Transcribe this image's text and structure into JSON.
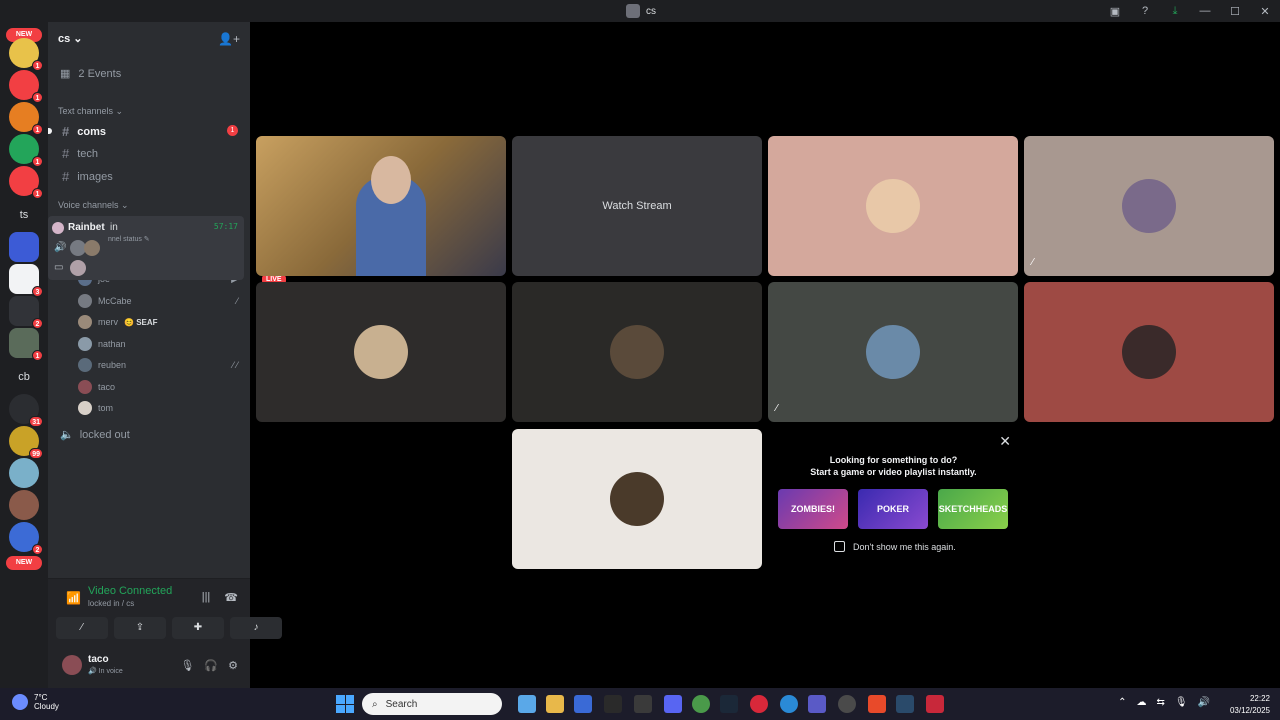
{
  "window": {
    "title": "cs"
  },
  "server": {
    "name": "cs",
    "events_label": "2 Events",
    "text_category": "Text channels",
    "text_channels": [
      {
        "name": "coms",
        "badge": "1"
      },
      {
        "name": "tech"
      },
      {
        "name": "images"
      }
    ],
    "voice_category": "Voice channels",
    "popup": {
      "server_name": "Rainbet",
      "channel_partial": "in",
      "timer": "57:17",
      "status_label": "nnel status"
    },
    "live_label": "LIVE",
    "voice_users": [
      {
        "name": "joe"
      },
      {
        "name": "McCabe"
      },
      {
        "name": "merv",
        "tag": "SEAF"
      },
      {
        "name": "nathan"
      },
      {
        "name": "reuben"
      },
      {
        "name": "taco"
      },
      {
        "name": "tom"
      }
    ],
    "locked_channel": "locked out"
  },
  "guilds": {
    "new_top": "NEW",
    "new_bottom": "NEW",
    "ts": "ts",
    "cb": "cb",
    "badges": [
      "1",
      "1",
      "1",
      "1",
      "1",
      "3",
      "2",
      "1",
      "31",
      "99",
      "2"
    ]
  },
  "voice_panel": {
    "status": "Video Connected",
    "subtitle": "locked in / cs"
  },
  "user": {
    "name": "taco",
    "status": "In voice"
  },
  "stage": {
    "watch_stream": "Watch Stream",
    "activity": {
      "line1": "Looking for something to do?",
      "line2": "Start a game or video playlist instantly.",
      "games": [
        "ZOMBIES!",
        "POKER",
        "SKETCHHEADS"
      ],
      "dont_show": "Don't show me this again."
    }
  },
  "taskbar": {
    "temp": "7°C",
    "condition": "Cloudy",
    "search": "Search",
    "time": "22:22",
    "date": "03/12/2025"
  }
}
